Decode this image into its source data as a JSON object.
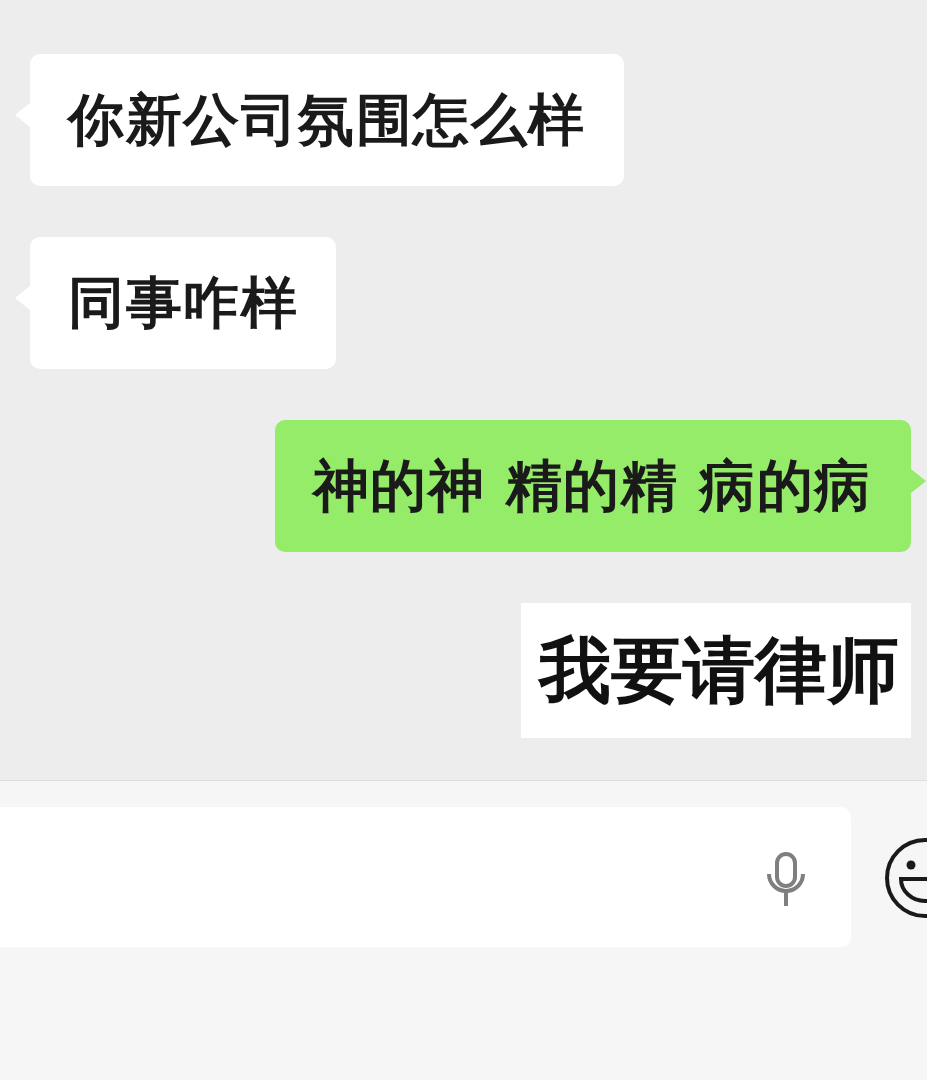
{
  "messages": [
    {
      "kind": "text",
      "outgoing": false,
      "text": "你新公司氛围怎么样"
    },
    {
      "kind": "text",
      "outgoing": false,
      "text": "同事咋样"
    },
    {
      "kind": "text",
      "outgoing": true,
      "text": "神的神 精的精 病的病"
    },
    {
      "kind": "sticker",
      "outgoing": true,
      "text": "我要请律师"
    }
  ]
}
